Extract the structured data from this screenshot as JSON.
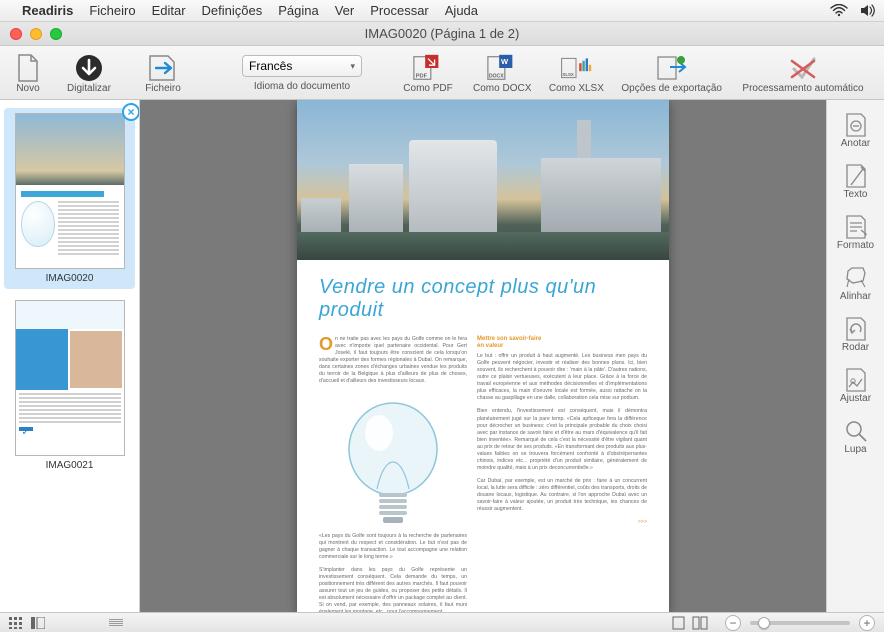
{
  "menubar": {
    "app": "Readiris",
    "items": [
      "Ficheiro",
      "Editar",
      "Definições",
      "Página",
      "Ver",
      "Processar",
      "Ajuda"
    ]
  },
  "window": {
    "title": "IMAG0020 (Página 1 de 2)"
  },
  "toolbar": {
    "novo": "Novo",
    "digitalizar": "Digitalizar",
    "ficheiro": "Ficheiro",
    "language_value": "Francês",
    "language_label": "Idioma do documento",
    "como_pdf": "Como PDF",
    "como_docx": "Como DOCX",
    "como_xlsx": "Como XLSX",
    "opcoes_export": "Opções de exportação",
    "auto": "Processamento automático"
  },
  "thumbnails": {
    "items": [
      {
        "label": "IMAG0020",
        "selected": true
      },
      {
        "label": "IMAG0021",
        "selected": false
      }
    ]
  },
  "document": {
    "headline": "Vendre un concept plus qu'un produit",
    "subhead_a": "Mettre son savoir-faire",
    "subhead_b": "en valeur",
    "more": ">>>",
    "left_intro": "On ne traite pas avec les pays du Golfe comme on le fera avec n'importe quel partenaire occidental. Pour Gert Joselé, il faut toujours être conscient de cela lorsqu'on souhaite exporter des formes régionales à Dubaï. On remarque, dans certaines zones d'échanges urbaines vendue les produits du terroir de la Belgique à plus d'ailleurs de plus de choses, d'accueil et d'ailleurs des investisseurs locaux.",
    "left_p2": "«Les pays du Golfe sont toujours à la recherche de partenaires qui montrent du respect et considération. Le but n'est pas de gagner à chaque transaction. Le tout accompagne une relation commerciale sur le long terme.»",
    "left_p3": "S'implanter dans les pays du Golfe représente un investissement conséquent. Cela demande du temps, un positionnement très différent des autres marchés. Il faut pouvoir assurer tout un jeu de guides, ou proposer des petits détails. Il est absolument nécessaire d'offrir un package complet au client. Si on vend, par exemple, des panneaux solaires, il faut muni également les montage, etc., pour l'accompagnement.",
    "right_p1": "Le but : offrir un produit à haut augmenté. Les business men pays du Golfe peuvent négocier, investir et réaliser des bonnes plans. Ici, bien souvent, ils recherchent à pouvoir dire : 'main à la pâte'. D'autres nations, outre ce plaisir vertueuses, exécutent à leur place. Grâce à la force de travail européenne et aux méthodes décisionnelles et d'implémentations plus efficaces, la main d'oeuvre locale est formée, aussi rattache on la chasse au gaspillage en une dalle, collaboration cela mise sur podium.",
    "right_p2": "Bien entendu, l'investissement est conséquent, mais il démontra planéairement jugé sur la pare temp. «Cela apficeque fera la différence pour décrocher un business: c'est la principale probable du choix choisi avec par instance de savoir faire et d'être au mars d'équivalence qu'il fait bien inventée». Remarqué de cela c'est la nécessité d'être vigilant quant au prix de retour de ses produits. «En transformant des produits aux plus-values faibles on se trouvera forcément confronté à d'obstréperrantes chinois, indices etc... propriété d'un produit similaire, généralement de moindre qualité, mais à un prix deconcurrentielle.»",
    "right_p3": "Car Dubaï, par exemple, est un marché de prix : faire à un concurrent local, la lutte sera difficile : zéro différentiel, coûts des transports, droits de douane locaux, logistique. Au contraire, si l'on approche Dubaï avec un savoir-faire à valeur ajoutée, un produit très technique, les chances de réussir augmentent."
  },
  "right_panel": {
    "anotar": "Anotar",
    "texto": "Texto",
    "formato": "Formato",
    "alinhar": "Alinhar",
    "rodar": "Rodar",
    "ajustar": "Ajustar",
    "lupa": "Lupa"
  }
}
